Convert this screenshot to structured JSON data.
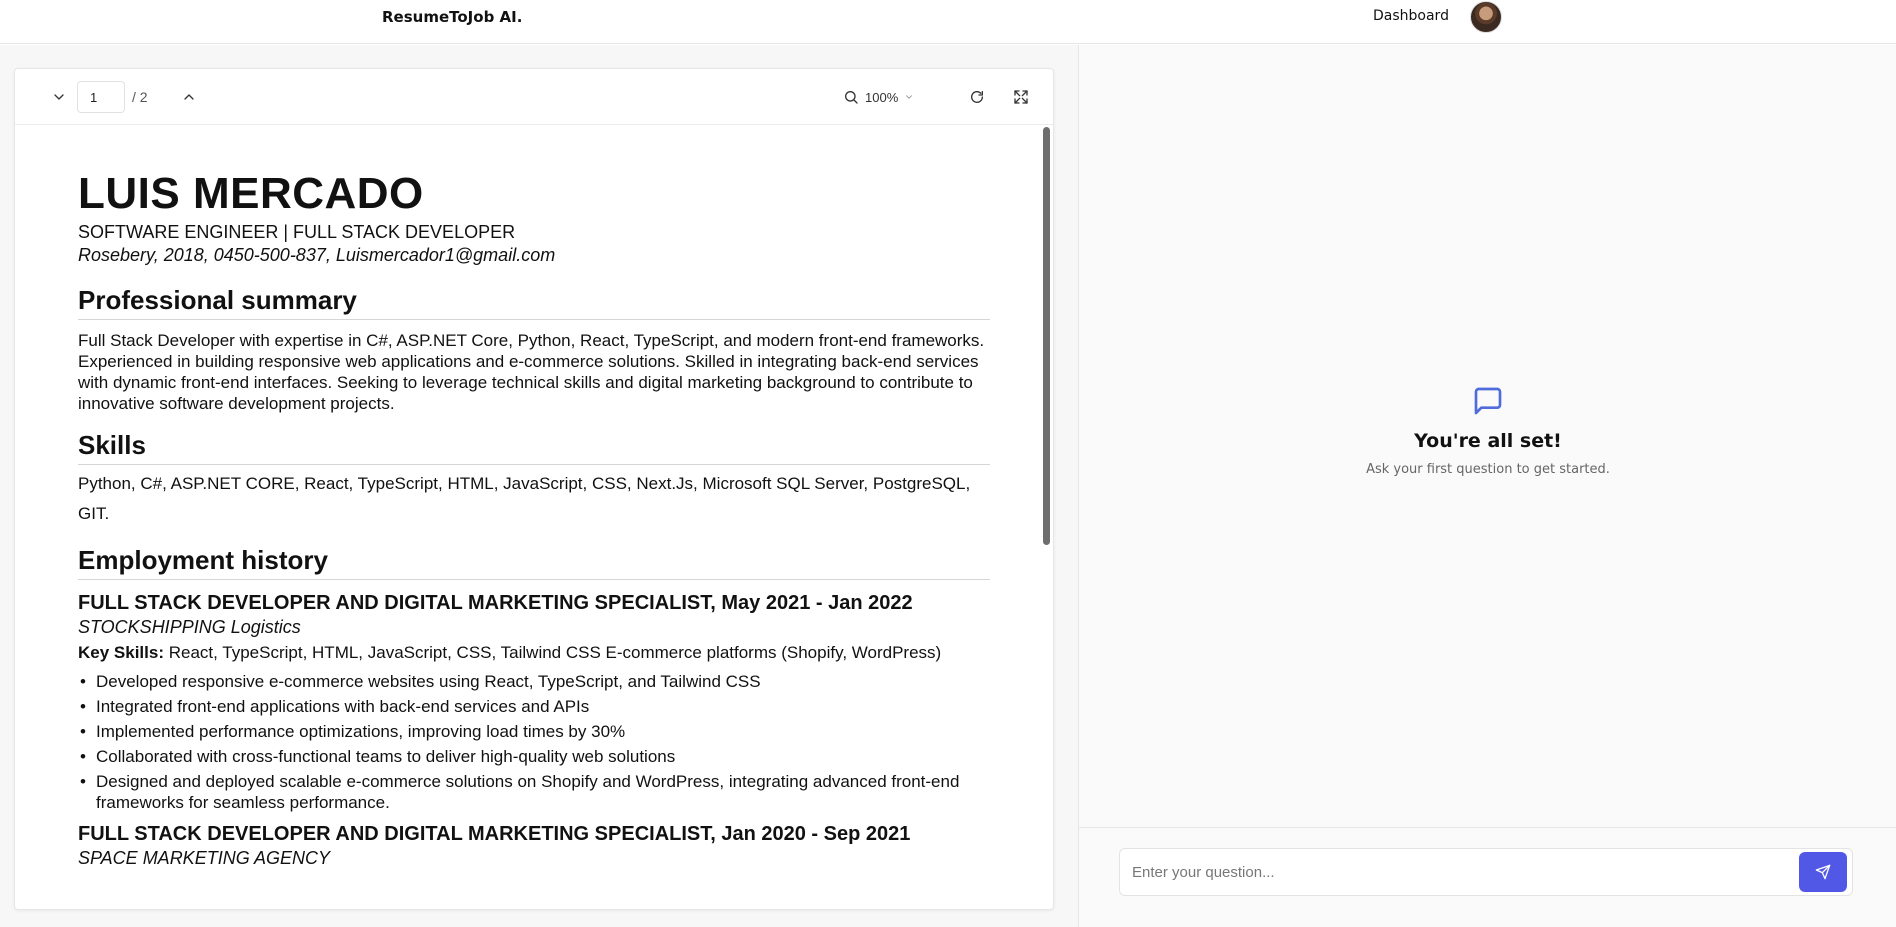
{
  "header": {
    "brand": "ResumeToJob AI.",
    "nav_dashboard": "Dashboard"
  },
  "viewer": {
    "current_page": "1",
    "page_total": "/ 2",
    "zoom": "100%"
  },
  "resume": {
    "name": "LUIS MERCADO",
    "subtitle": "SOFTWARE ENGINEER | FULL STACK DEVELOPER",
    "contact": "Rosebery, 2018, 0450-500-837, Luismercador1@gmail.com",
    "summary_heading": "Professional summary",
    "summary": "Full Stack Developer with expertise in C#, ASP.NET Core, Python, React, TypeScript, and modern front-end frameworks. Experienced in building responsive web applications and e-commerce solutions. Skilled in integrating back-end services with dynamic front-end interfaces. Seeking to leverage technical skills and digital marketing background to contribute to innovative software development projects.",
    "skills_heading": "Skills",
    "skills": "Python, C#, ASP.NET CORE, React, TypeScript, HTML, JavaScript, CSS, Next.Js, Microsoft SQL Server, PostgreSQL, GIT.",
    "employment_heading": "Employment history",
    "jobs": [
      {
        "title": "FULL STACK DEVELOPER AND DIGITAL MARKETING SPECIALIST, May 2021 - Jan 2022",
        "company": "STOCKSHIPPING Logistics",
        "key_skills_label": "Key Skills:",
        "key_skills": " React, TypeScript, HTML, JavaScript, CSS, Tailwind CSS E-commerce platforms (Shopify, WordPress)",
        "bullets": [
          "Developed responsive e-commerce websites using React, TypeScript, and Tailwind CSS",
          "Integrated front-end applications with back-end services and APIs",
          "Implemented performance optimizations, improving load times by 30%",
          "Collaborated with cross-functional teams to deliver high-quality web solutions",
          "Designed and deployed scalable e-commerce solutions on Shopify and WordPress, integrating advanced front-end frameworks for seamless performance."
        ]
      },
      {
        "title": "FULL STACK DEVELOPER AND DIGITAL MARKETING SPECIALIST, Jan 2020 - Sep 2021",
        "company": "SPACE MARKETING AGENCY"
      }
    ]
  },
  "chat": {
    "empty_title": "You're all set!",
    "empty_subtitle": "Ask your first question to get started.",
    "input_placeholder": "Enter your question..."
  },
  "colors": {
    "accent": "#5158e6",
    "icon_accent": "#4f6bdc"
  }
}
